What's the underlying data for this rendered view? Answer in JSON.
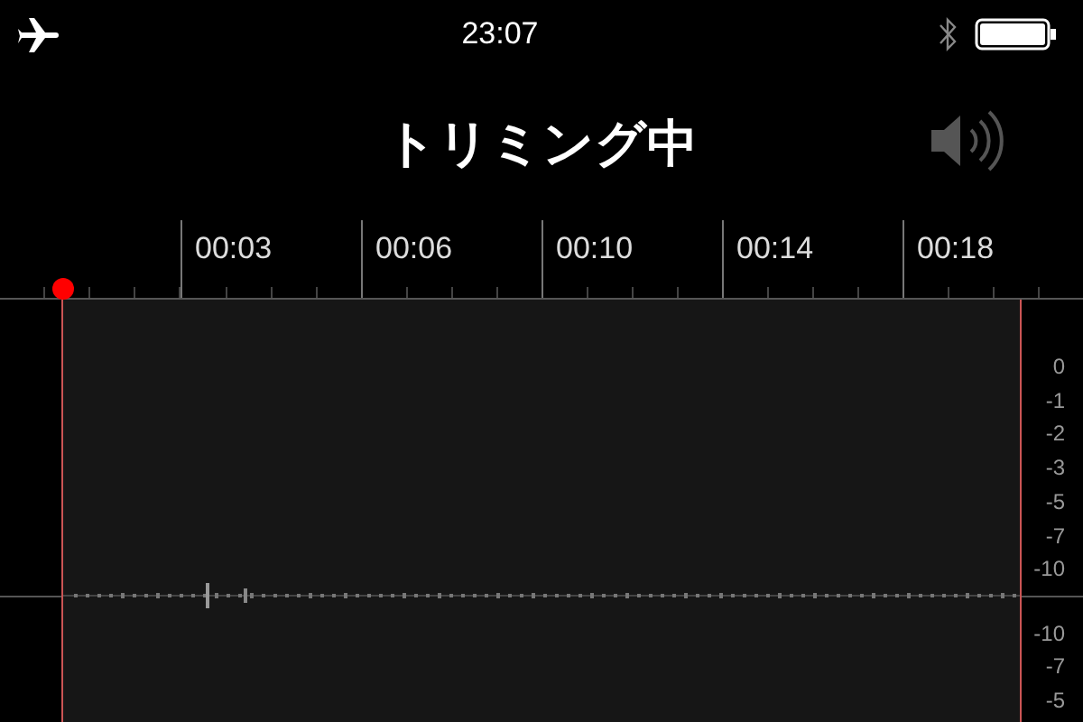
{
  "status_bar": {
    "time": "23:07"
  },
  "title": "トリミング中",
  "timeline": {
    "labels": [
      "00:03",
      "00:06",
      "00:10",
      "00:14",
      "00:18"
    ]
  },
  "level_scale": {
    "upper": [
      "0",
      "-1",
      "-2",
      "-3",
      "-5",
      "-7",
      "-10"
    ],
    "lower": [
      "-10",
      "-7",
      "-5"
    ]
  }
}
